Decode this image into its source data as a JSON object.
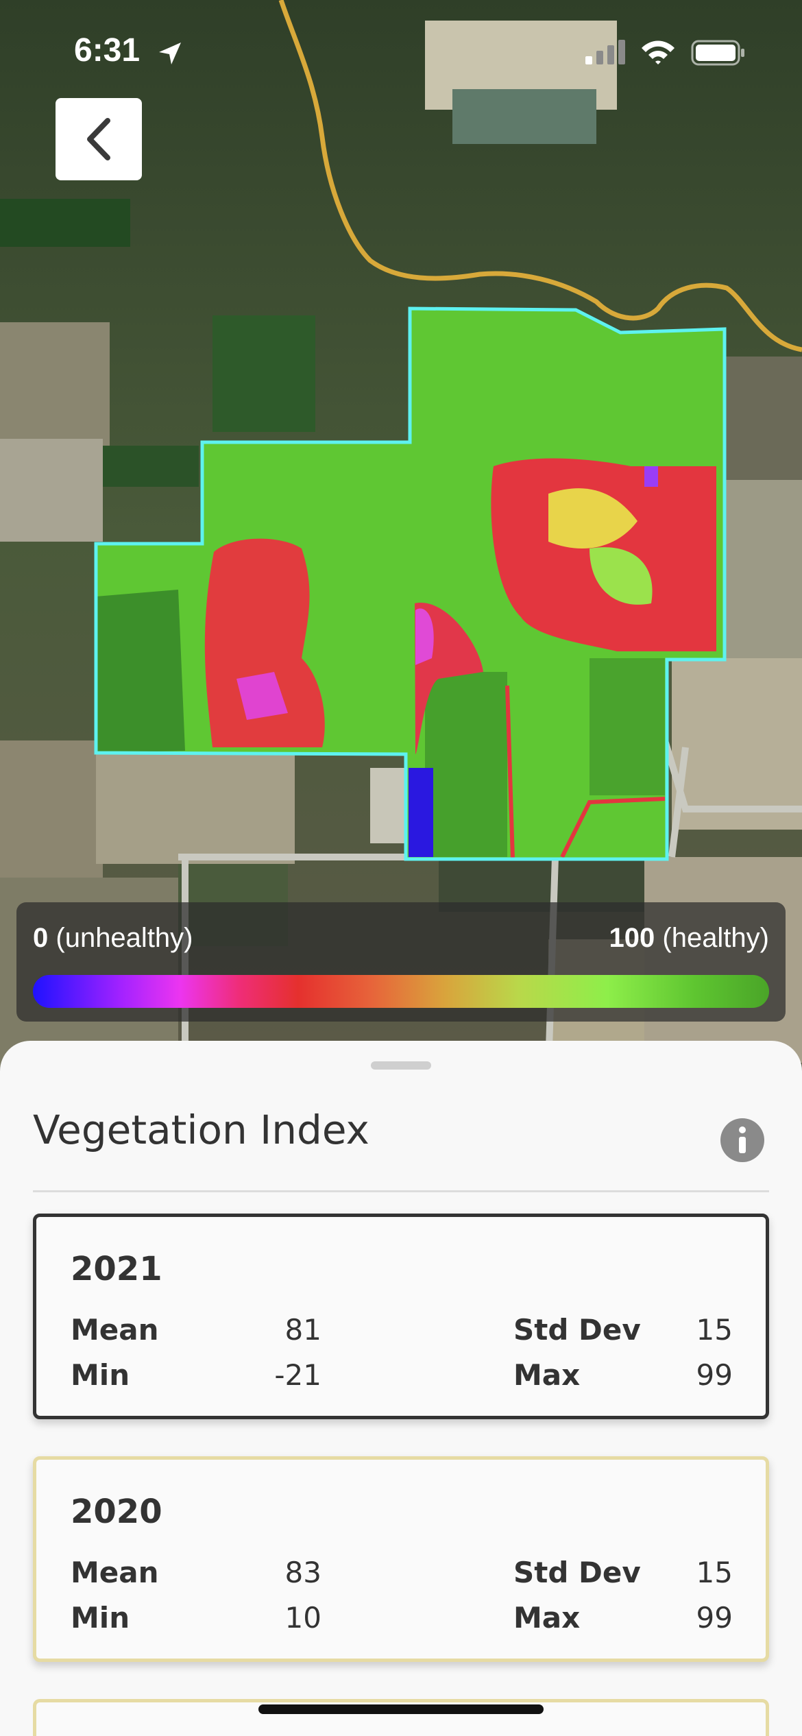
{
  "status_bar": {
    "time": "6:31"
  },
  "legend": {
    "min_value": "0",
    "min_label": "(unhealthy)",
    "max_value": "100",
    "max_label": "(healthy)"
  },
  "sheet": {
    "title": "Vegetation Index",
    "cards": [
      {
        "year": "2021",
        "selected": true,
        "mean_label": "Mean",
        "mean": "81",
        "min_label": "Min",
        "min": "-21",
        "std_label": "Std Dev",
        "std": "15",
        "max_label": "Max",
        "max": "99"
      },
      {
        "year": "2020",
        "selected": false,
        "mean_label": "Mean",
        "mean": "83",
        "min_label": "Min",
        "min": "10",
        "std_label": "Std Dev",
        "std": "15",
        "max_label": "Max",
        "max": "99"
      }
    ]
  },
  "colors": {
    "field_outline": "#5ef2f0",
    "road": "#d8a93a",
    "selected_border": "#333333",
    "unselected_border": "#e6dba3"
  },
  "icons": {
    "back": "chevron-left-icon",
    "info": "info-icon",
    "location": "location-arrow-icon",
    "signal": "signal-icon",
    "wifi": "wifi-icon",
    "battery": "battery-icon"
  }
}
